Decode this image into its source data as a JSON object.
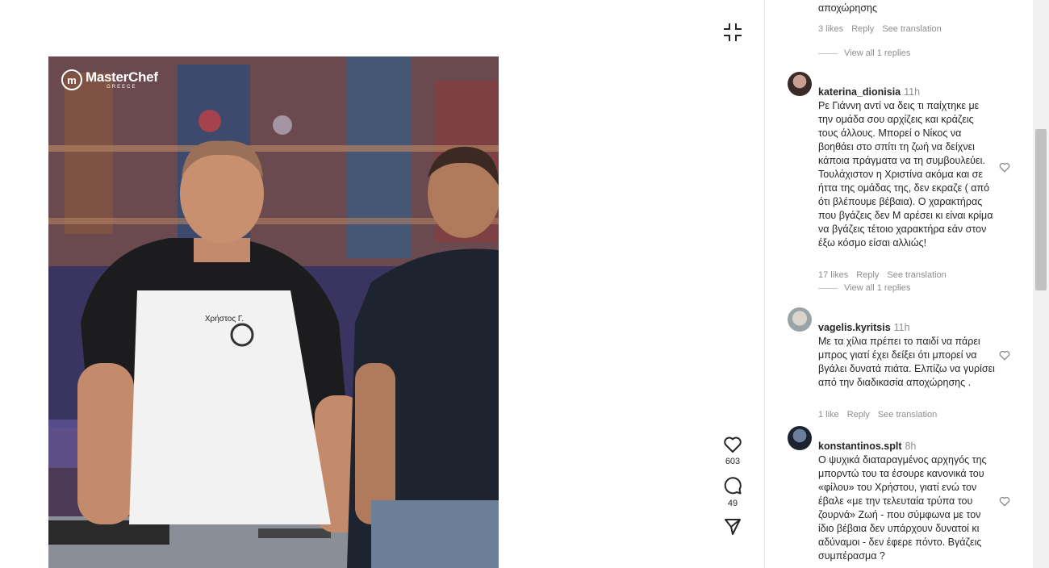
{
  "post": {
    "brand_name": "MasterChef",
    "brand_sub": "GREECE",
    "apron_label": "Χρήστος Γ.",
    "likes": "603",
    "comments": "49"
  },
  "icons": {
    "collapse": "collapse-icon",
    "like": "heart-icon",
    "comment": "comment-icon",
    "share": "send-icon"
  },
  "top_comment": {
    "text_tail": "αποχώρησης",
    "likes": "3 likes",
    "reply": "Reply",
    "translate": "See translation",
    "view_replies": "View all 1 replies"
  },
  "comments": [
    {
      "username": "katerina_dionisia",
      "time": "11h",
      "text": "Ρε Γιάννη αντί να δεις τι παίχτηκε με την ομάδα σου αρχίζεις και κράζεις τους άλλους. Μπορεί ο Νίκος να βοηθάει στο σπίτι τη ζωή να δείχνει κάποια πράγματα να τη συμβουλεύει. Τουλάχιστον η Χριστίνα ακόμα και σε ήττα της ομάδας της, δεν εκραζε ( από ότι βλέπουμε βέβαια). Ο χαρακτήρας που βγάζεις δεν Μ αρέσει κι είναι κρίμα να βγάζεις τέτοιο χαρακτήρα εάν στον έξω κόσμο είσαι αλλιώς!",
      "likes": "17 likes",
      "reply": "Reply",
      "translate": "See translation",
      "view_replies": "View all 1 replies"
    },
    {
      "username": "vagelis.kyritsis",
      "time": "11h",
      "text": "Με τα χίλια πρέπει το παιδί να πάρει μπρος γιατί έχει δείξει ότι μπορεί να βγάλει δυνατά πιάτα. Ελπίζω να γυρίσει από την διαδικασία αποχώρησης .",
      "likes": "1 like",
      "reply": "Reply",
      "translate": "See translation"
    },
    {
      "username": "konstantinos.splt",
      "time": "8h",
      "text": "Ο ψυχικά διαταραγμένος αρχηγός της μπορντώ του τα έσουρε κανονικά του «φίλου» του Χρήστου, γιατί ενώ τον έβαλε «με την τελευταία τρύπα του ζουρνά» Ζωή - που σύμφωνα με τον ίδιο βέβαια δεν υπάρχουν δυνατοί κι αδύναμοι - δεν έφερε πόντο. Βγάζεις συμπέρασμα ?"
    }
  ]
}
